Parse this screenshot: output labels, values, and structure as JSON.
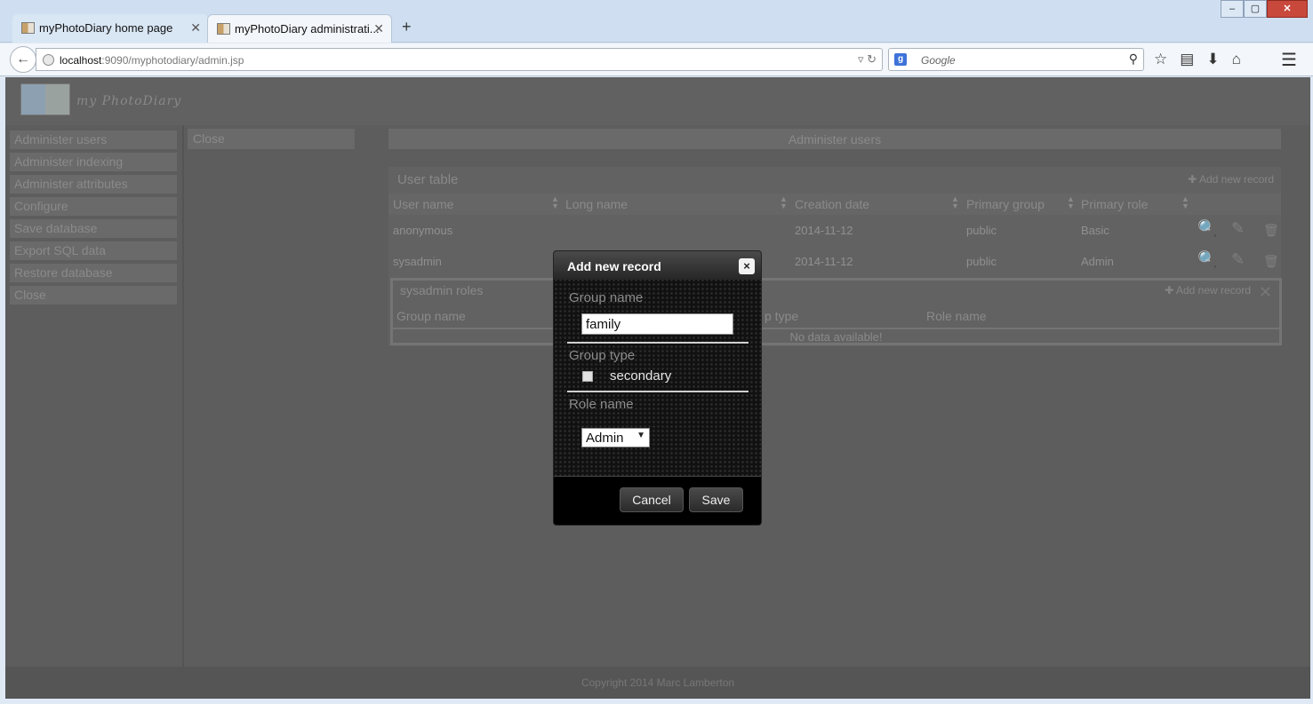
{
  "browser": {
    "tabs": [
      {
        "label": "myPhotoDiary home page",
        "active": false
      },
      {
        "label": "myPhotoDiary administrati...",
        "active": true
      }
    ],
    "new_tab_label": "+",
    "url_host": "localhost",
    "url_rest": ":9090/myphotodiary/admin.jsp",
    "search_placeholder": "Google",
    "window_buttons": {
      "minimize": "–",
      "maximize": "▢",
      "close": "✕"
    }
  },
  "header": {
    "logo_text": "my PhotoDiary"
  },
  "sidebar": {
    "items": [
      {
        "label": "Administer users"
      },
      {
        "label": "Administer indexing"
      },
      {
        "label": "Administer attributes"
      },
      {
        "label": "Configure"
      },
      {
        "label": "Save database"
      },
      {
        "label": "Export SQL data"
      },
      {
        "label": "Restore database"
      },
      {
        "label": "Close"
      }
    ]
  },
  "subpanel": {
    "close_label": "Close"
  },
  "main": {
    "title": "Administer users",
    "user_table": {
      "title": "User table",
      "add_label": "Add new record",
      "columns": [
        "User name",
        "Long name",
        "Creation date",
        "Primary group",
        "Primary role"
      ],
      "rows": [
        {
          "user": "anonymous",
          "long_name": "",
          "created": "2014-11-12",
          "group": "public",
          "role": "Basic"
        },
        {
          "user": "sysadmin",
          "long_name": "",
          "created": "2014-11-12",
          "group": "public",
          "role": "Admin"
        }
      ]
    },
    "roles_table": {
      "title": "sysadmin roles",
      "add_label": "Add new record",
      "columns": [
        "Group name",
        "p type",
        "Role name"
      ],
      "empty_text": "No data available!"
    }
  },
  "footer": {
    "copyright": "Copyright 2014 Marc Lamberton"
  },
  "modal": {
    "title": "Add new record",
    "close_glyph": "×",
    "group_name_label": "Group name",
    "group_name_value": "family",
    "group_type_label": "Group type",
    "group_type_option": "secondary",
    "group_type_checked": false,
    "role_name_label": "Role name",
    "role_name_value": "Admin",
    "cancel_label": "Cancel",
    "save_label": "Save"
  },
  "colors": {
    "overlay": "#5d5d5d",
    "modal_bg": "#111111",
    "browser_chrome": "#cfdff1"
  }
}
